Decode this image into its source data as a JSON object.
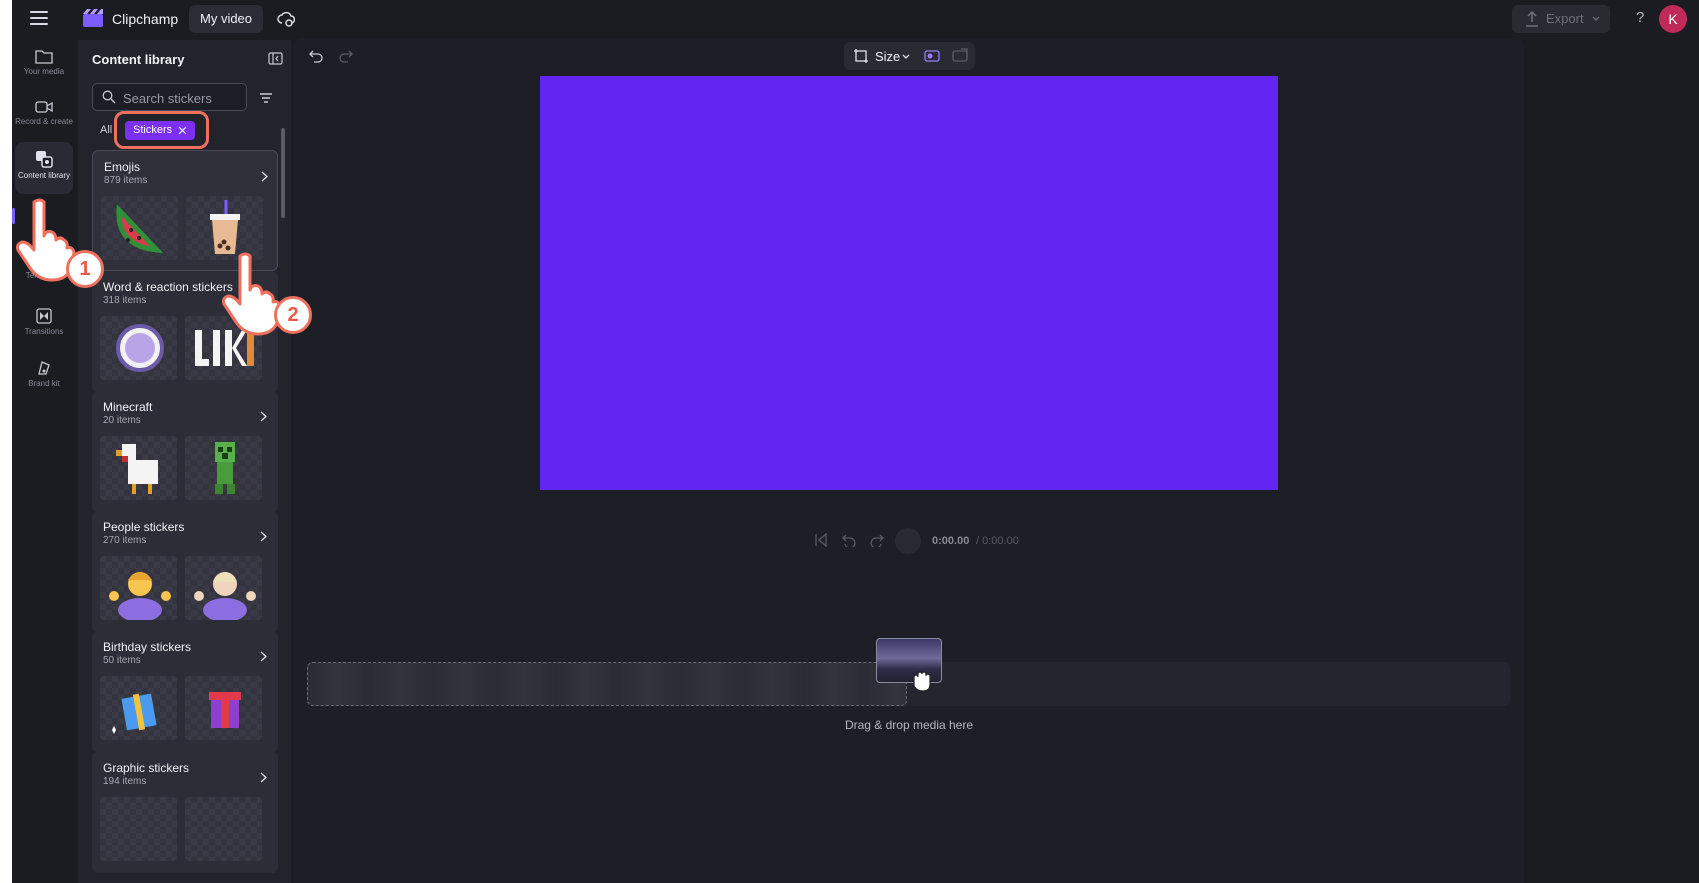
{
  "topbar": {
    "app_name": "Clipchamp",
    "video_title": "My video",
    "export_label": "Export",
    "help_label": "?",
    "avatar_initial": "K"
  },
  "rail": {
    "items": [
      {
        "label": "Your media",
        "icon": "folder-icon"
      },
      {
        "label": "Record & create",
        "icon": "camera-icon"
      },
      {
        "label": "Content library",
        "icon": "content-library-icon",
        "active": true
      },
      {
        "label": "Templates",
        "icon": "templates-icon"
      },
      {
        "label": "Transitions",
        "icon": "transitions-icon"
      },
      {
        "label": "Brand kit",
        "icon": "brand-kit-icon"
      }
    ]
  },
  "library": {
    "title": "Content library",
    "search_placeholder": "Search stickers",
    "filter_all": "All",
    "active_filter_chip": "Stickers",
    "categories": [
      {
        "name": "Emojis",
        "count": "879 items"
      },
      {
        "name": "Word & reaction stickers",
        "count": "318 items"
      },
      {
        "name": "Minecraft",
        "count": "20 items"
      },
      {
        "name": "People stickers",
        "count": "270 items"
      },
      {
        "name": "Birthday stickers",
        "count": "50 items"
      },
      {
        "name": "Graphic stickers",
        "count": "194 items"
      }
    ]
  },
  "editor": {
    "size_label": "Size",
    "time_current": "0:00.00",
    "time_total": "/ 0:00.00",
    "drop_label": "Drag & drop media here",
    "canvas_color": "#6326f0"
  },
  "annotations": {
    "step_1": "1",
    "step_2": "2",
    "accent_color": "#f0705e"
  }
}
